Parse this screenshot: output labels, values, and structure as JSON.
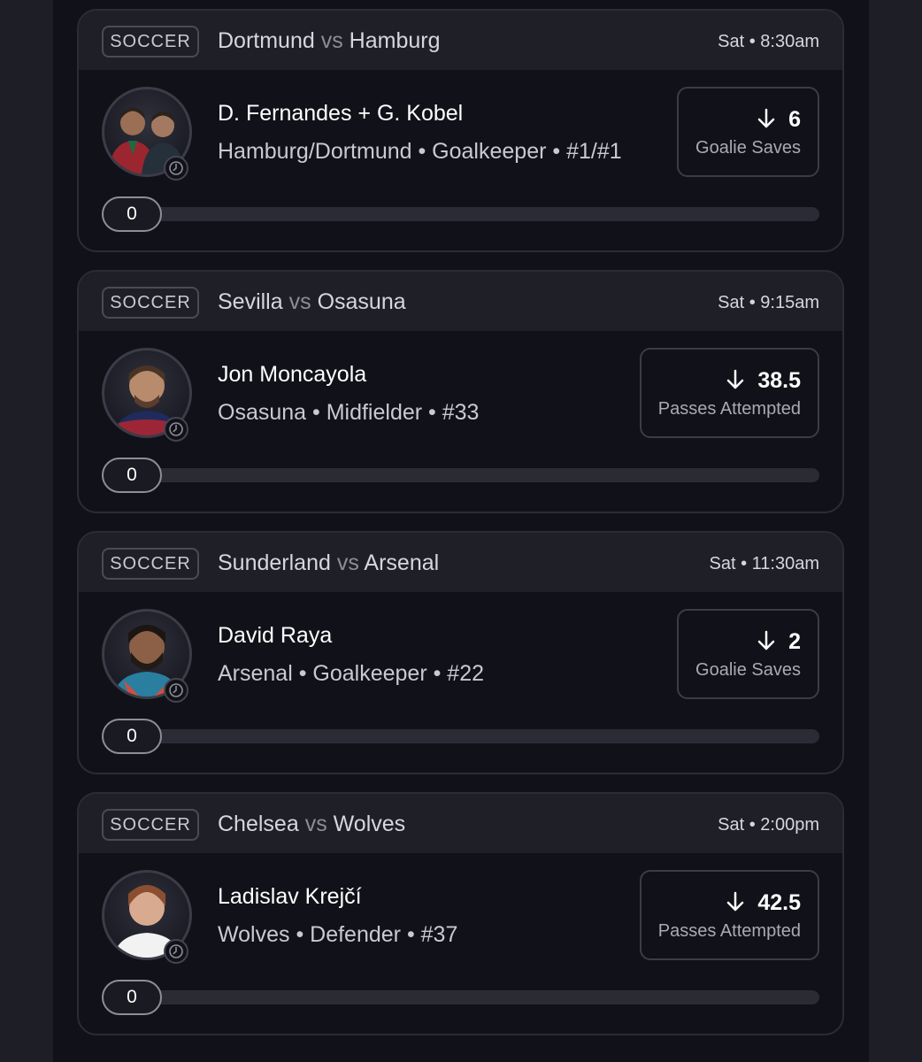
{
  "cards": [
    {
      "sport": "SOCCER",
      "team_a": "Dortmund",
      "vs": "vs",
      "team_b": "Hamburg",
      "time": "Sat • 8:30am",
      "player": "D. Fernandes + G. Kobel",
      "details": "Hamburg/Dortmund • Goalkeeper • #1/#1",
      "line": "6",
      "stat": "Goalie Saves",
      "direction": "down",
      "progress_value": "0",
      "progress_fraction": 0
    },
    {
      "sport": "SOCCER",
      "team_a": "Sevilla",
      "vs": "vs",
      "team_b": "Osasuna",
      "time": "Sat • 9:15am",
      "player": "Jon Moncayola",
      "details": "Osasuna • Midfielder • #33",
      "line": "38.5",
      "stat": "Passes Attempted",
      "direction": "down",
      "progress_value": "0",
      "progress_fraction": 0
    },
    {
      "sport": "SOCCER",
      "team_a": "Sunderland",
      "vs": "vs",
      "team_b": "Arsenal",
      "time": "Sat • 11:30am",
      "player": "David Raya",
      "details": "Arsenal • Goalkeeper • #22",
      "line": "2",
      "stat": "Goalie Saves",
      "direction": "down",
      "progress_value": "0",
      "progress_fraction": 0
    },
    {
      "sport": "SOCCER",
      "team_a": "Chelsea",
      "vs": "vs",
      "team_b": "Wolves",
      "time": "Sat • 2:00pm",
      "player": "Ladislav Krejčí",
      "details": "Wolves • Defender • #37",
      "line": "42.5",
      "stat": "Passes Attempted",
      "direction": "down",
      "progress_value": "0",
      "progress_fraction": 0
    }
  ],
  "icons": {
    "direction": "arrow-down-icon",
    "clock": "clock-icon",
    "avatar": "player-headshot"
  },
  "colors": {
    "page_background": "#1e1f26",
    "card_background": "#111119",
    "header_background": "#1f1f28",
    "border": "#2b2c37",
    "muted_text": "#c9cad1"
  }
}
